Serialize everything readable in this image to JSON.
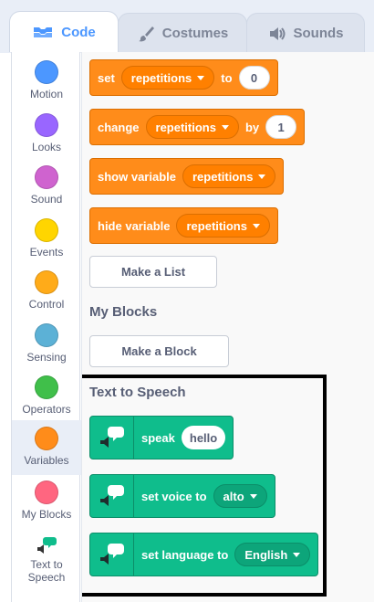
{
  "tabs": [
    {
      "label": "Code",
      "icon": "code-icon",
      "active": true
    },
    {
      "label": "Costumes",
      "icon": "paintbrush-icon",
      "active": false
    },
    {
      "label": "Sounds",
      "icon": "speaker-icon",
      "active": false
    }
  ],
  "categories": [
    {
      "label": "Motion",
      "color": "#4c97ff"
    },
    {
      "label": "Looks",
      "color": "#9966ff"
    },
    {
      "label": "Sound",
      "color": "#cf63cf"
    },
    {
      "label": "Events",
      "color": "#ffd500"
    },
    {
      "label": "Control",
      "color": "#ffab19"
    },
    {
      "label": "Sensing",
      "color": "#5cb1d6"
    },
    {
      "label": "Operators",
      "color": "#40bf4a"
    },
    {
      "label": "Variables",
      "color": "#ff8c1a",
      "selected": true
    },
    {
      "label": "My Blocks",
      "color": "#ff6680"
    },
    {
      "label": "Text to Speech",
      "icon": "text-to-speech-icon"
    }
  ],
  "variable_blocks": {
    "set": {
      "verb": "set",
      "variable": "repetitions",
      "to_label": "to",
      "value": "0"
    },
    "change": {
      "verb": "change",
      "variable": "repetitions",
      "by_label": "by",
      "value": "1"
    },
    "show": {
      "verb": "show variable",
      "variable": "repetitions"
    },
    "hide": {
      "verb": "hide variable",
      "variable": "repetitions"
    },
    "make_list": "Make a List"
  },
  "my_blocks": {
    "title": "My Blocks",
    "make_block": "Make a Block"
  },
  "text_to_speech": {
    "title": "Text to Speech",
    "speak": {
      "label": "speak",
      "value": "hello"
    },
    "set_voice": {
      "label": "set voice to",
      "value": "alto"
    },
    "set_language": {
      "label": "set language to",
      "value": "English"
    }
  },
  "colors": {
    "variables_block": "#ff8c1a",
    "tts_block": "#0fbd8c",
    "accent": "#4c97ff"
  }
}
